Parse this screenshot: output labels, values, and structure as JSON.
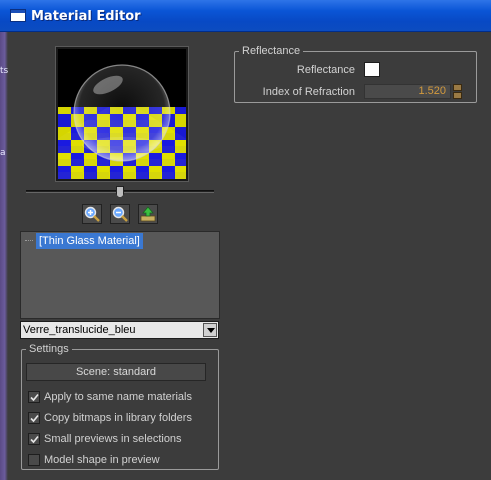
{
  "window": {
    "title": "Material Editor"
  },
  "desktop": {
    "edge_glyphs": [
      "ts",
      "a"
    ]
  },
  "preview": {
    "toolbar": [
      {
        "name": "zoom-in-icon"
      },
      {
        "name": "zoom-out-icon"
      },
      {
        "name": "export-icon"
      }
    ]
  },
  "tree": {
    "selected_item": "[Thin Glass Material]"
  },
  "material_select": {
    "value": "Verre_translucide_bleu"
  },
  "settings": {
    "legend": "Settings",
    "scene_button": "Scene: standard",
    "options": [
      {
        "label": "Apply to same name materials",
        "checked": true
      },
      {
        "label": "Copy bitmaps in library folders",
        "checked": true
      },
      {
        "label": "Small previews in selections",
        "checked": true
      },
      {
        "label": "Model shape in preview",
        "checked": false
      }
    ]
  },
  "reflectance": {
    "legend": "Reflectance",
    "reflectance_label": "Reflectance",
    "reflectance_color": "#ffffff",
    "ior_label": "Index of Refraction",
    "ior_value": "1.520"
  },
  "colors": {
    "titlebar": "#0a55d6",
    "panel": "#3c3c3c",
    "selection": "#3a78d2",
    "value_accent": "#d39a3e",
    "checker_blue": "#1a1ae0",
    "checker_yellow": "#e0e000"
  }
}
